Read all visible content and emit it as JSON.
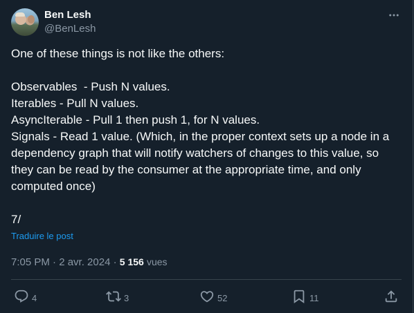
{
  "author": {
    "display_name": "Ben Lesh",
    "handle": "@BenLesh",
    "avatar_icon": "user-avatar-photo"
  },
  "tweet": {
    "lines": [
      "One of these things is not like the others:",
      "",
      "Observables  - Push N values.",
      "Iterables - Pull N values.",
      "AsyncIterable - Pull 1 then push 1, for N values.",
      "Signals - Read 1 value. (Which, in the proper context sets up a node in a dependency graph that will notify watchers of changes to this value, so they can be read by the consumer at the appropriate time, and only computed once)",
      "",
      "7/"
    ],
    "translate_label": "Traduire le post",
    "timestamp": "7:05 PM · 2 avr. 2024",
    "separator": " · ",
    "views_count": "5 156",
    "views_label": "vues"
  },
  "actions": {
    "reply_count": "4",
    "retweet_count": "3",
    "like_count": "52",
    "bookmark_count": "11"
  },
  "colors": {
    "background": "#15202b",
    "text_primary": "#f7f9f9",
    "text_secondary": "#8b98a5",
    "accent": "#1d9bf0",
    "border": "#38444d"
  },
  "icons": {
    "more": "more-dots-icon",
    "reply": "reply-bubble-icon",
    "retweet": "retweet-icon",
    "like": "heart-icon",
    "bookmark": "bookmark-icon",
    "share": "share-upload-icon"
  }
}
